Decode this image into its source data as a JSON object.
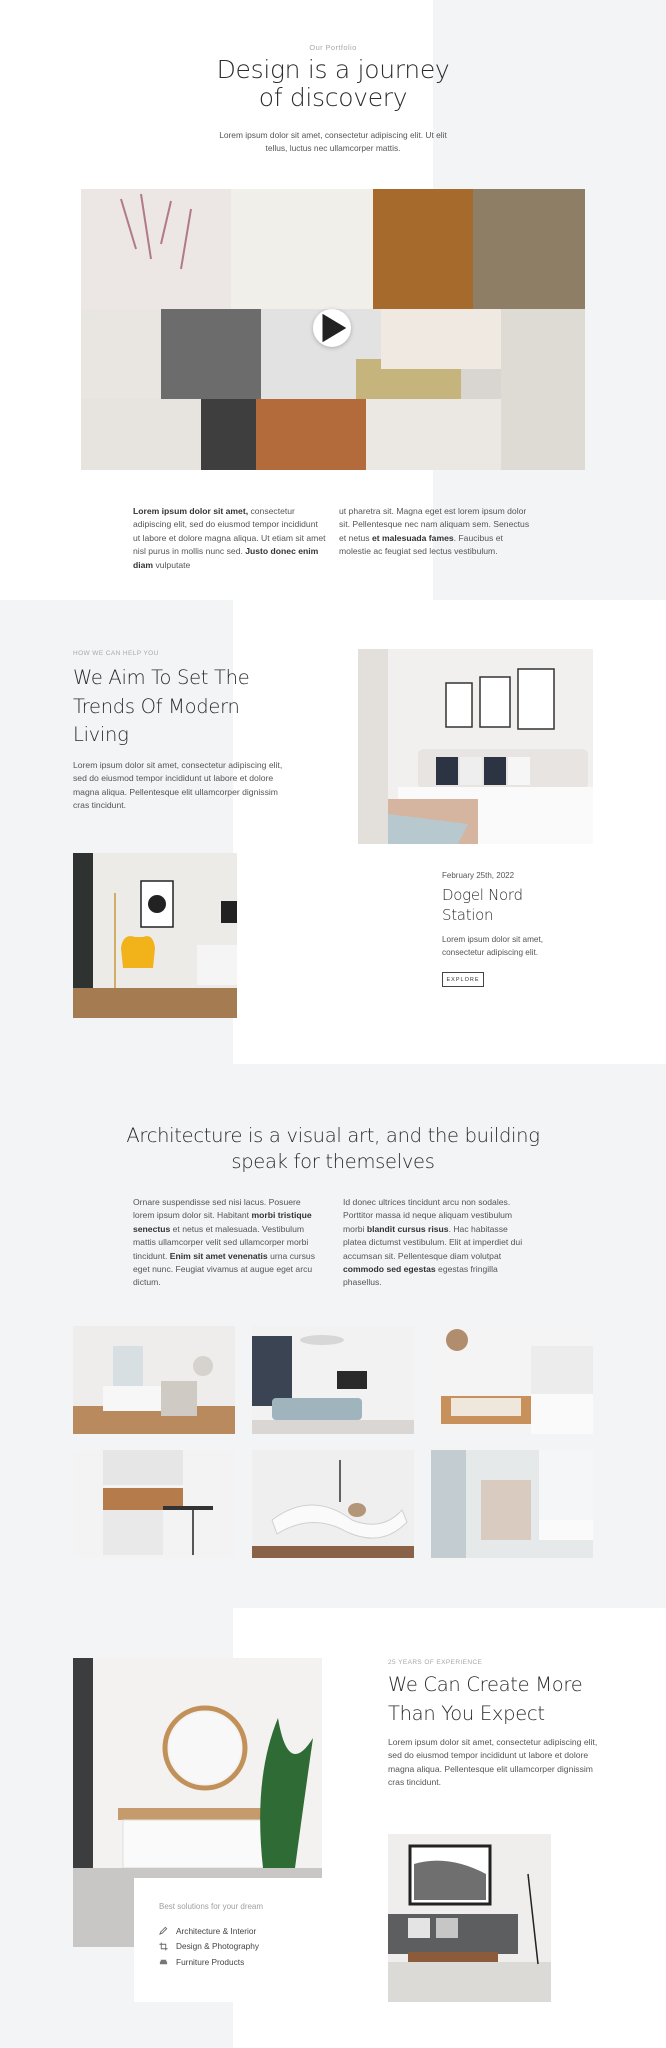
{
  "portfolio": {
    "eyebrow": "Our Portfolio",
    "title_line1": "Design is a journey",
    "title_line2": "of discovery",
    "intro_line1": "Lorem ipsum dolor sit amet, consectetur adipiscing elit. Ut elit",
    "intro_line2": "tellus, luctus nec ullamcorper mattis.",
    "col1": {
      "b1": "Lorem ipsum dolor sit amet,",
      "t1": " consectetur adipiscing elit, sed do eiusmod tempor incididunt ut labore et dolore magna aliqua. Ut etiam sit amet nisl purus in mollis nunc sed. ",
      "b2": "Justo donec enim diam",
      "t2": " vulputate"
    },
    "col2": {
      "t1": "ut pharetra sit. Magna eget est lorem ipsum dolor sit. Pellentesque nec nam aliquam sem. Senectus et netus ",
      "b1": "et malesuada fames",
      "t2": ". Faucibus et molestie ac feugiat sed lectus vestibulum."
    }
  },
  "aim": {
    "eyebrow": "How we can help you",
    "title_line1": "We Aim To Set The",
    "title_line2": "Trends Of Modern",
    "title_line3": "Living",
    "body": "Lorem ipsum dolor sit amet, consectetur adipiscing elit, sed do eiusmod tempor incididunt ut labore et dolore magna aliqua. Pellentesque elit ullamcorper dignissim cras tincidunt.",
    "card": {
      "date": "February 25th, 2022",
      "title_line1": "Dogel Nord",
      "title_line2": "Station",
      "body": "Lorem ipsum dolor sit amet, consectetur adipiscing elit.",
      "button": "Explore"
    }
  },
  "architecture": {
    "title_line1": "Architecture is a visual art, and the building",
    "title_line2": "speak for themselves",
    "col1": {
      "t1": "Ornare suspendisse sed nisi lacus. Posuere lorem ipsum dolor sit. Habitant ",
      "b1": "morbi tristique senectus",
      "t2": " et netus et malesuada. Vestibulum mattis ullamcorper velit sed ullamcorper morbi tincidunt. ",
      "b2": "Enim sit amet venenatis",
      "t3": " urna cursus eget nunc. Feugiat vivamus at augue eget arcu dictum."
    },
    "col2": {
      "t1": "Id donec ultrices tincidunt arcu non sodales. Porttitor massa id neque aliquam vestibulum morbi ",
      "b1": "blandit cursus risus",
      "t2": ". Hac habitasse platea dictumst vestibulum. Elit at imperdiet dui accumsan sit. Pellentesque diam volutpat ",
      "b2": "commodo sed egestas",
      "t3": " egestas fringilla phasellus."
    }
  },
  "experience": {
    "eyebrow": "25 Years of Experience",
    "title_line1": "We Can Create More",
    "title_line2": "Than You Expect",
    "body": "Lorem ipsum dolor sit amet, consectetur adipiscing elit, sed do eiusmod tempor incididunt ut labore et dolore magna aliqua. Pellentesque elit ullamcorper dignissim cras tincidunt.",
    "solutions": {
      "heading": "Best solutions for your dream",
      "items": [
        {
          "label": "Architecture & Interior",
          "icon": "pencil-icon"
        },
        {
          "label": "Design & Photography",
          "icon": "crop-icon"
        },
        {
          "label": "Furniture Products",
          "icon": "sofa-icon"
        }
      ]
    }
  },
  "colors": {
    "section_grey": "#f3f4f6",
    "heading": "#2b2b2b",
    "text": "#555555"
  }
}
